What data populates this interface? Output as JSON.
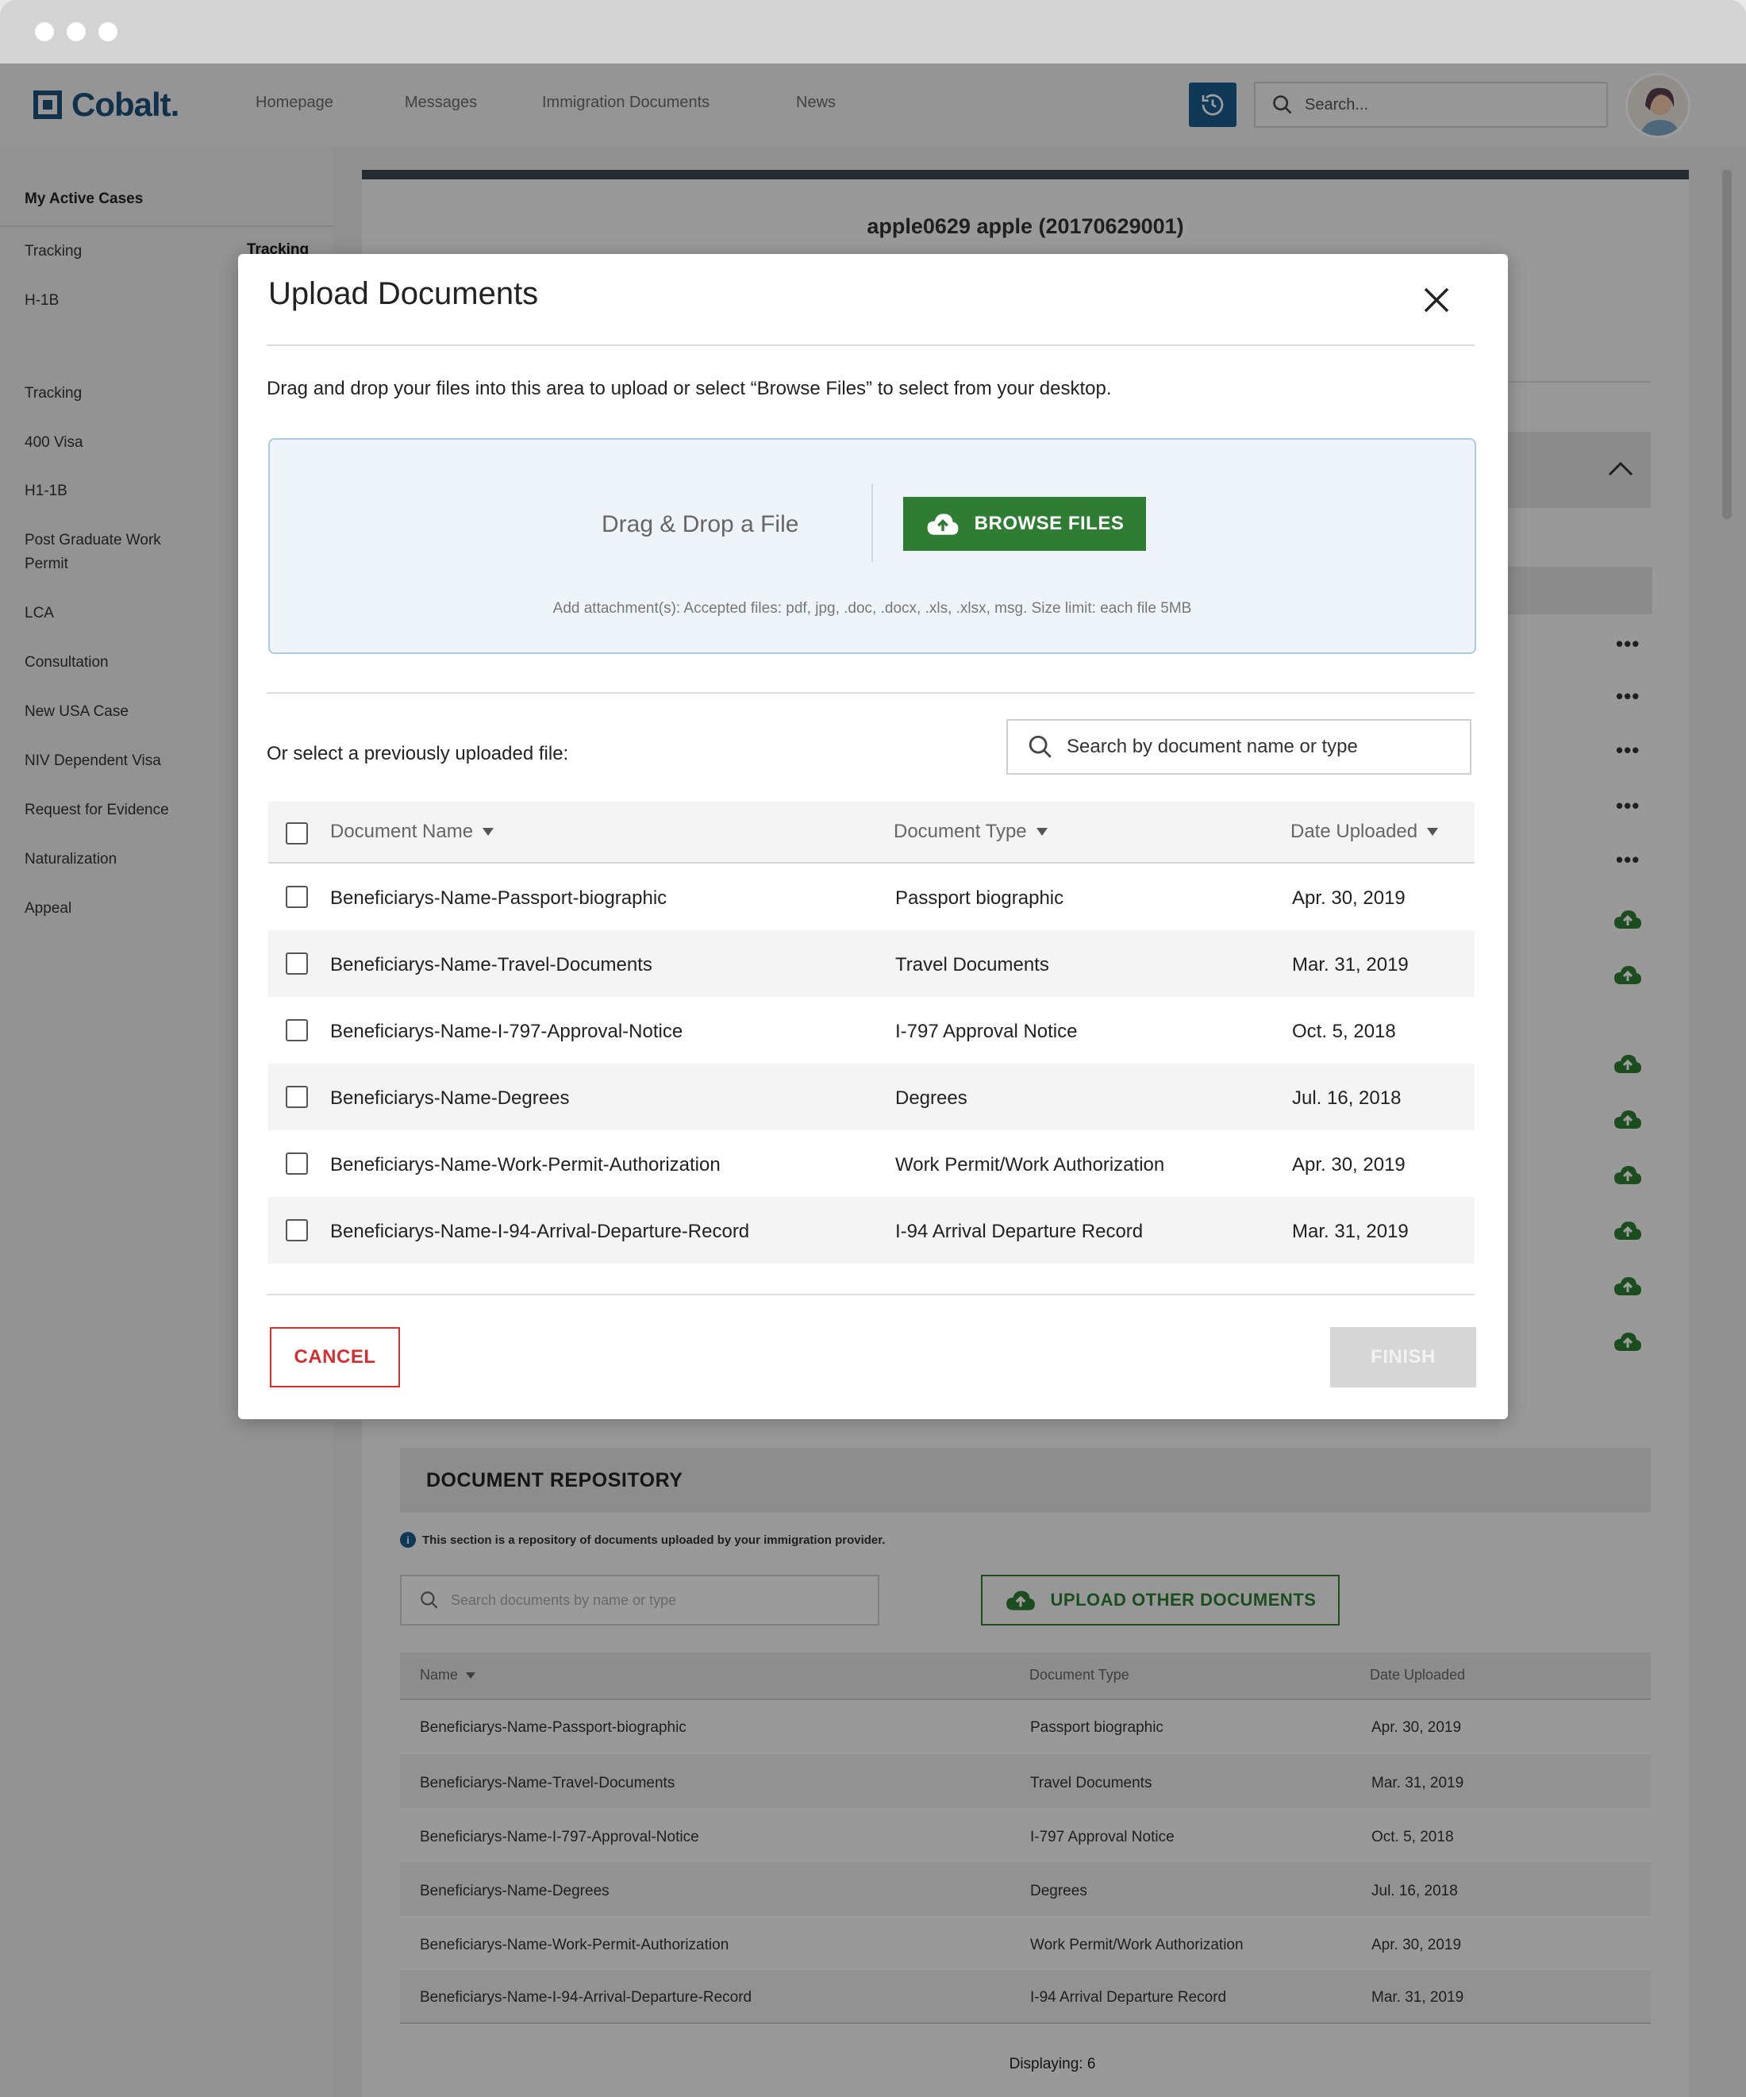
{
  "header": {
    "brand": "Cobalt.",
    "nav": [
      "Homepage",
      "Messages",
      "Immigration Documents",
      "News"
    ],
    "search_placeholder": "Search..."
  },
  "sidebar": {
    "heading": "My Active Cases",
    "items": [
      "Tracking",
      "H-1B",
      "Tracking",
      "400 Visa",
      "H1-1B",
      "Post Graduate Work Permit",
      "LCA",
      "Consultation",
      "New USA Case",
      "NIV Dependent Visa",
      "Request for Evidence",
      "Naturalization",
      "Appeal"
    ],
    "column2_label": "Tracking"
  },
  "main": {
    "case_title": "apple0629 apple (20170629001)"
  },
  "modal": {
    "title": "Upload Documents",
    "description": "Drag and drop your files into this area to upload or select “Browse Files” to select from your desktop.",
    "dropzone_label": "Drag & Drop a File",
    "browse_label": "BROWSE FILES",
    "hint": "Add attachment(s): Accepted files: pdf, jpg, .doc, .docx, .xls, .xlsx, msg. Size limit: each file 5MB",
    "or_select": "Or select a previously uploaded file:",
    "search_placeholder": "Search by document name or type",
    "columns": [
      "Document Name",
      "Document Type",
      "Date Uploaded"
    ],
    "rows": [
      {
        "name": "Beneficiarys-Name-Passport-biographic",
        "type": "Passport biographic",
        "date": "Apr. 30, 2019"
      },
      {
        "name": "Beneficiarys-Name-Travel-Documents",
        "type": "Travel Documents",
        "date": "Mar. 31, 2019"
      },
      {
        "name": "Beneficiarys-Name-I-797-Approval-Notice",
        "type": "I-797 Approval Notice",
        "date": "Oct. 5, 2018"
      },
      {
        "name": "Beneficiarys-Name-Degrees",
        "type": "Degrees",
        "date": "Jul. 16, 2018"
      },
      {
        "name": "Beneficiarys-Name-Work-Permit-Authorization",
        "type": "Work Permit/Work Authorization",
        "date": "Apr. 30, 2019"
      },
      {
        "name": "Beneficiarys-Name-I-94-Arrival-Departure-Record",
        "type": "I-94 Arrival Departure Record",
        "date": "Mar. 31, 2019"
      }
    ],
    "cancel_label": "CANCEL",
    "finish_label": "FINISH"
  },
  "repository": {
    "title": "DOCUMENT REPOSITORY",
    "note": "This section is a repository of documents uploaded by your immigration provider.",
    "search_placeholder": "Search documents by name or type",
    "upload_label": "UPLOAD OTHER DOCUMENTS",
    "columns": [
      "Name",
      "Document Type",
      "Date Uploaded"
    ],
    "rows": [
      {
        "name": "Beneficiarys-Name-Passport-biographic",
        "type": "Passport biographic",
        "date": "Apr. 30, 2019"
      },
      {
        "name": "Beneficiarys-Name-Travel-Documents",
        "type": "Travel Documents",
        "date": "Mar. 31, 2019"
      },
      {
        "name": "Beneficiarys-Name-I-797-Approval-Notice",
        "type": "I-797 Approval Notice",
        "date": "Oct. 5, 2018"
      },
      {
        "name": "Beneficiarys-Name-Degrees",
        "type": "Degrees",
        "date": "Jul. 16, 2018"
      },
      {
        "name": "Beneficiarys-Name-Work-Permit-Authorization",
        "type": "Work Permit/Work Authorization",
        "date": "Apr. 30, 2019"
      },
      {
        "name": "Beneficiarys-Name-I-94-Arrival-Departure-Record",
        "type": "I-94 Arrival Departure Record",
        "date": "Mar. 31, 2019"
      }
    ],
    "displaying": "Displaying: 6"
  },
  "colors": {
    "brand": "#1d4f7a",
    "accent_green": "#2e7d32",
    "danger": "#d32f2f",
    "history_button": "#1b5c8f"
  }
}
